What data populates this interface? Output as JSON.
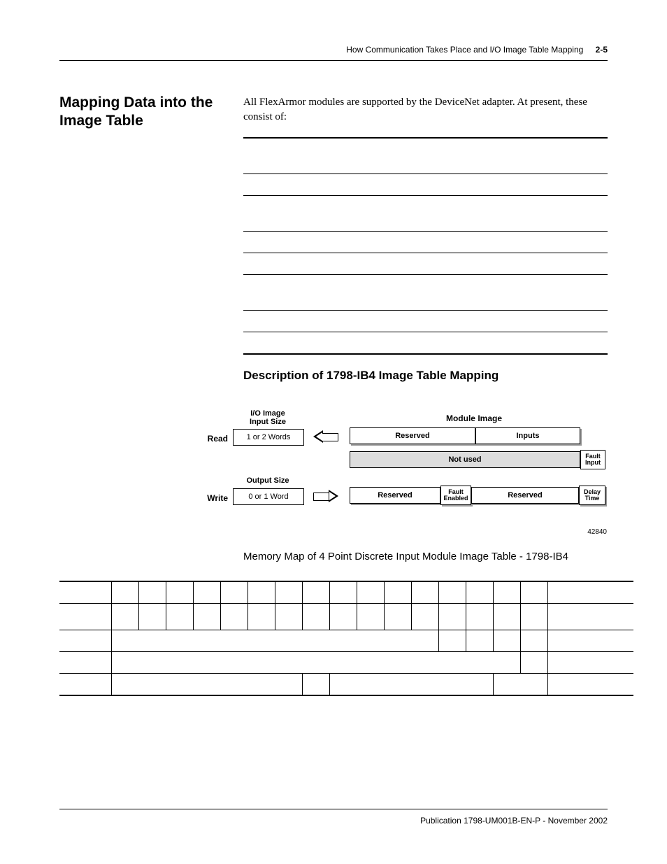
{
  "header": {
    "running": "How Communication Takes Place and I/O Image Table Mapping",
    "page": "2-5"
  },
  "section_title": "Mapping Data into the Image Table",
  "intro": "All FlexArmor modules are supported by the DeviceNet adapter. At present, these consist of:",
  "subheading": "Description of 1798-IB4 Image Table Mapping",
  "diagram": {
    "io_image_input_size": "I/O Image\nInput Size",
    "module_image": "Module Image",
    "read": "Read",
    "read_box": "1 or 2 Words",
    "output_size": "Output Size",
    "write": "Write",
    "write_box": "0 or 1 Word",
    "reserved1": "Reserved",
    "inputs": "Inputs",
    "not_used": "Not used",
    "fault_input": "Fault\nInput",
    "reserved2": "Reserved",
    "fault_enabled": "Fault\nEnabled",
    "reserved3": "Reserved",
    "delay_time": "Delay\nTime",
    "fignum": "42840"
  },
  "mem_title": "Memory Map of 4 Point Discrete Input Module Image Table - 1798-IB4",
  "footer": "Publication 1798-UM001B-EN-P - November 2002"
}
